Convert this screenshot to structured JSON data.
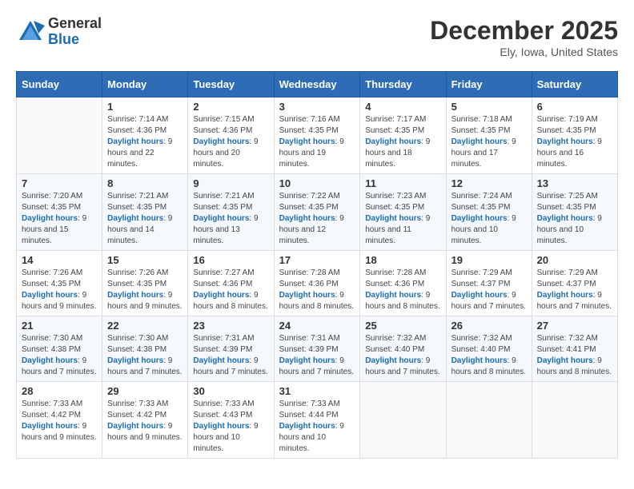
{
  "header": {
    "logo_general": "General",
    "logo_blue": "Blue",
    "month_title": "December 2025",
    "location": "Ely, Iowa, United States"
  },
  "days_of_week": [
    "Sunday",
    "Monday",
    "Tuesday",
    "Wednesday",
    "Thursday",
    "Friday",
    "Saturday"
  ],
  "weeks": [
    [
      {
        "day": "",
        "sunrise": "",
        "sunset": "",
        "daylight": ""
      },
      {
        "day": "1",
        "sunrise": "Sunrise: 7:14 AM",
        "sunset": "Sunset: 4:36 PM",
        "daylight": "Daylight: 9 hours and 22 minutes."
      },
      {
        "day": "2",
        "sunrise": "Sunrise: 7:15 AM",
        "sunset": "Sunset: 4:36 PM",
        "daylight": "Daylight: 9 hours and 20 minutes."
      },
      {
        "day": "3",
        "sunrise": "Sunrise: 7:16 AM",
        "sunset": "Sunset: 4:35 PM",
        "daylight": "Daylight: 9 hours and 19 minutes."
      },
      {
        "day": "4",
        "sunrise": "Sunrise: 7:17 AM",
        "sunset": "Sunset: 4:35 PM",
        "daylight": "Daylight: 9 hours and 18 minutes."
      },
      {
        "day": "5",
        "sunrise": "Sunrise: 7:18 AM",
        "sunset": "Sunset: 4:35 PM",
        "daylight": "Daylight: 9 hours and 17 minutes."
      },
      {
        "day": "6",
        "sunrise": "Sunrise: 7:19 AM",
        "sunset": "Sunset: 4:35 PM",
        "daylight": "Daylight: 9 hours and 16 minutes."
      }
    ],
    [
      {
        "day": "7",
        "sunrise": "Sunrise: 7:20 AM",
        "sunset": "Sunset: 4:35 PM",
        "daylight": "Daylight: 9 hours and 15 minutes."
      },
      {
        "day": "8",
        "sunrise": "Sunrise: 7:21 AM",
        "sunset": "Sunset: 4:35 PM",
        "daylight": "Daylight: 9 hours and 14 minutes."
      },
      {
        "day": "9",
        "sunrise": "Sunrise: 7:21 AM",
        "sunset": "Sunset: 4:35 PM",
        "daylight": "Daylight: 9 hours and 13 minutes."
      },
      {
        "day": "10",
        "sunrise": "Sunrise: 7:22 AM",
        "sunset": "Sunset: 4:35 PM",
        "daylight": "Daylight: 9 hours and 12 minutes."
      },
      {
        "day": "11",
        "sunrise": "Sunrise: 7:23 AM",
        "sunset": "Sunset: 4:35 PM",
        "daylight": "Daylight: 9 hours and 11 minutes."
      },
      {
        "day": "12",
        "sunrise": "Sunrise: 7:24 AM",
        "sunset": "Sunset: 4:35 PM",
        "daylight": "Daylight: 9 hours and 10 minutes."
      },
      {
        "day": "13",
        "sunrise": "Sunrise: 7:25 AM",
        "sunset": "Sunset: 4:35 PM",
        "daylight": "Daylight: 9 hours and 10 minutes."
      }
    ],
    [
      {
        "day": "14",
        "sunrise": "Sunrise: 7:26 AM",
        "sunset": "Sunset: 4:35 PM",
        "daylight": "Daylight: 9 hours and 9 minutes."
      },
      {
        "day": "15",
        "sunrise": "Sunrise: 7:26 AM",
        "sunset": "Sunset: 4:35 PM",
        "daylight": "Daylight: 9 hours and 9 minutes."
      },
      {
        "day": "16",
        "sunrise": "Sunrise: 7:27 AM",
        "sunset": "Sunset: 4:36 PM",
        "daylight": "Daylight: 9 hours and 8 minutes."
      },
      {
        "day": "17",
        "sunrise": "Sunrise: 7:28 AM",
        "sunset": "Sunset: 4:36 PM",
        "daylight": "Daylight: 9 hours and 8 minutes."
      },
      {
        "day": "18",
        "sunrise": "Sunrise: 7:28 AM",
        "sunset": "Sunset: 4:36 PM",
        "daylight": "Daylight: 9 hours and 8 minutes."
      },
      {
        "day": "19",
        "sunrise": "Sunrise: 7:29 AM",
        "sunset": "Sunset: 4:37 PM",
        "daylight": "Daylight: 9 hours and 7 minutes."
      },
      {
        "day": "20",
        "sunrise": "Sunrise: 7:29 AM",
        "sunset": "Sunset: 4:37 PM",
        "daylight": "Daylight: 9 hours and 7 minutes."
      }
    ],
    [
      {
        "day": "21",
        "sunrise": "Sunrise: 7:30 AM",
        "sunset": "Sunset: 4:38 PM",
        "daylight": "Daylight: 9 hours and 7 minutes."
      },
      {
        "day": "22",
        "sunrise": "Sunrise: 7:30 AM",
        "sunset": "Sunset: 4:38 PM",
        "daylight": "Daylight: 9 hours and 7 minutes."
      },
      {
        "day": "23",
        "sunrise": "Sunrise: 7:31 AM",
        "sunset": "Sunset: 4:39 PM",
        "daylight": "Daylight: 9 hours and 7 minutes."
      },
      {
        "day": "24",
        "sunrise": "Sunrise: 7:31 AM",
        "sunset": "Sunset: 4:39 PM",
        "daylight": "Daylight: 9 hours and 7 minutes."
      },
      {
        "day": "25",
        "sunrise": "Sunrise: 7:32 AM",
        "sunset": "Sunset: 4:40 PM",
        "daylight": "Daylight: 9 hours and 7 minutes."
      },
      {
        "day": "26",
        "sunrise": "Sunrise: 7:32 AM",
        "sunset": "Sunset: 4:40 PM",
        "daylight": "Daylight: 9 hours and 8 minutes."
      },
      {
        "day": "27",
        "sunrise": "Sunrise: 7:32 AM",
        "sunset": "Sunset: 4:41 PM",
        "daylight": "Daylight: 9 hours and 8 minutes."
      }
    ],
    [
      {
        "day": "28",
        "sunrise": "Sunrise: 7:33 AM",
        "sunset": "Sunset: 4:42 PM",
        "daylight": "Daylight: 9 hours and 9 minutes."
      },
      {
        "day": "29",
        "sunrise": "Sunrise: 7:33 AM",
        "sunset": "Sunset: 4:42 PM",
        "daylight": "Daylight: 9 hours and 9 minutes."
      },
      {
        "day": "30",
        "sunrise": "Sunrise: 7:33 AM",
        "sunset": "Sunset: 4:43 PM",
        "daylight": "Daylight: 9 hours and 10 minutes."
      },
      {
        "day": "31",
        "sunrise": "Sunrise: 7:33 AM",
        "sunset": "Sunset: 4:44 PM",
        "daylight": "Daylight: 9 hours and 10 minutes."
      },
      {
        "day": "",
        "sunrise": "",
        "sunset": "",
        "daylight": ""
      },
      {
        "day": "",
        "sunrise": "",
        "sunset": "",
        "daylight": ""
      },
      {
        "day": "",
        "sunrise": "",
        "sunset": "",
        "daylight": ""
      }
    ]
  ]
}
